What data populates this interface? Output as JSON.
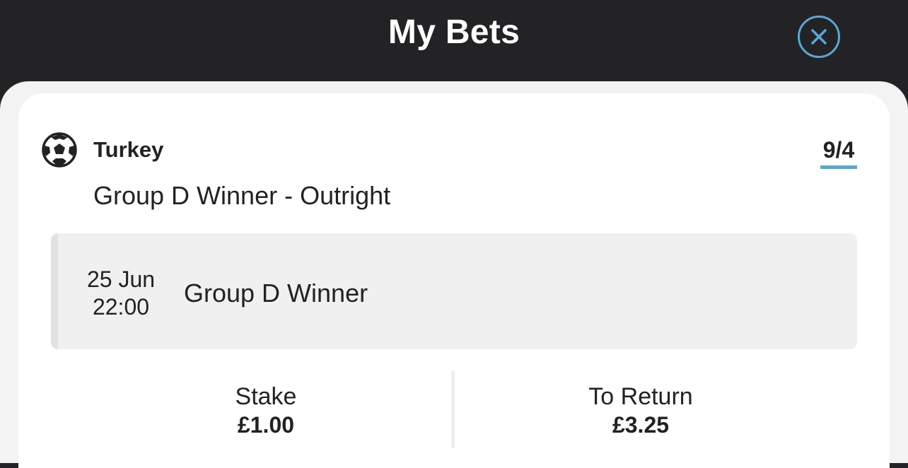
{
  "header": {
    "title": "My Bets",
    "close_icon": "close-circle-icon",
    "accent_color": "#5aa7d4"
  },
  "bet": {
    "sport_icon": "football-icon",
    "selection": "Turkey",
    "odds": "9/4",
    "market": "Group D Winner - Outright",
    "event": {
      "date": "25 Jun",
      "time": "22:00",
      "name": "Group D Winner"
    },
    "stake_label": "Stake",
    "stake_value": "£1.00",
    "return_label": "To Return",
    "return_value": "£3.25"
  }
}
